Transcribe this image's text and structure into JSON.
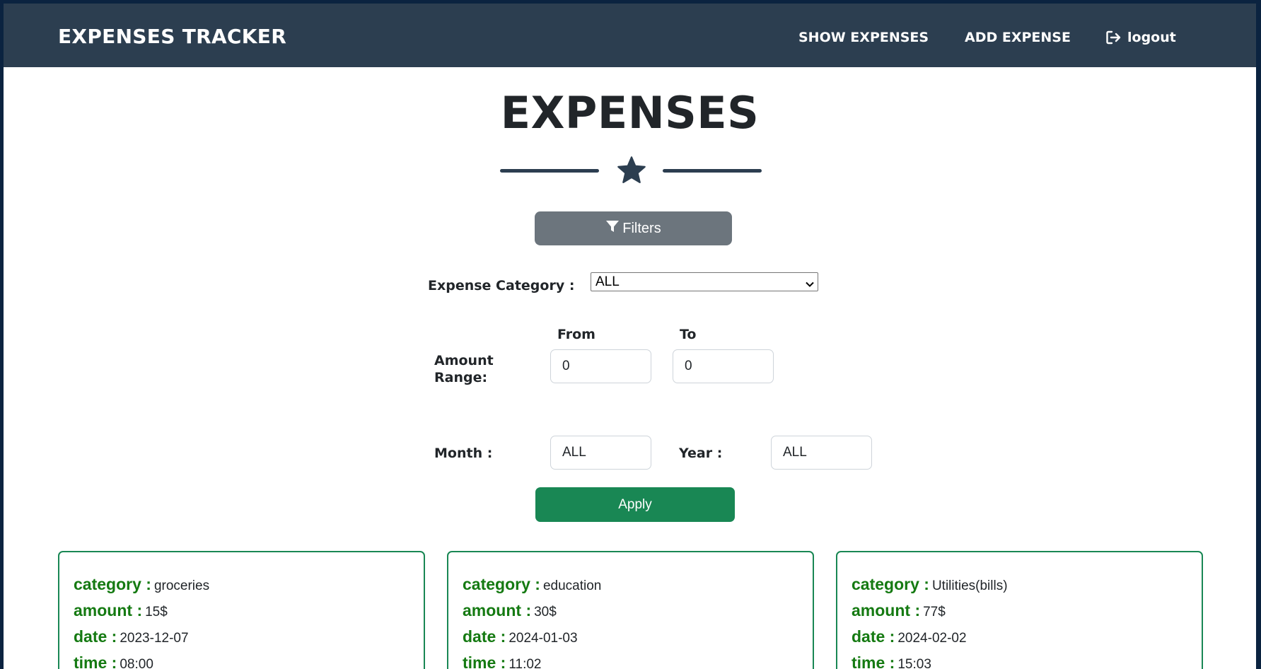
{
  "navbar": {
    "brand": "EXPENSES TRACKER",
    "links": {
      "show_expenses": "SHOW EXPENSES",
      "add_expense": "ADD EXPENSE",
      "logout": "logout"
    }
  },
  "main": {
    "title": "EXPENSES",
    "filters_button": "Filters",
    "category_label": "Expense Category :",
    "category_selected": "ALL",
    "amount_label_line1": "Amount",
    "amount_label_line2": "Range:",
    "from_label": "From",
    "to_label": "To",
    "from_value": "0",
    "to_value": "0",
    "month_label": "Month :",
    "month_value": "ALL",
    "year_label": "Year :",
    "year_value": "ALL",
    "apply_button": "Apply"
  },
  "card_keys": {
    "category": "category :",
    "amount": "amount :",
    "date": "date :",
    "time": "time :"
  },
  "expenses": [
    {
      "category": "groceries",
      "amount": "15$",
      "date": "2023-12-07",
      "time": "08:00"
    },
    {
      "category": "education",
      "amount": "30$",
      "date": "2024-01-03",
      "time": "11:02"
    },
    {
      "category": "Utilities(bills)",
      "amount": "77$",
      "date": "2024-02-02",
      "time": "15:03"
    }
  ],
  "colors": {
    "navbar_bg": "#2c3e50",
    "filters_bg": "#6c757d",
    "apply_bg": "#198754",
    "card_border": "#198754",
    "card_key": "#157a12"
  },
  "icons": {
    "divider": "star-icon",
    "filters": "filter-icon",
    "logout": "logout-icon",
    "select": "chevron-down-icon"
  }
}
